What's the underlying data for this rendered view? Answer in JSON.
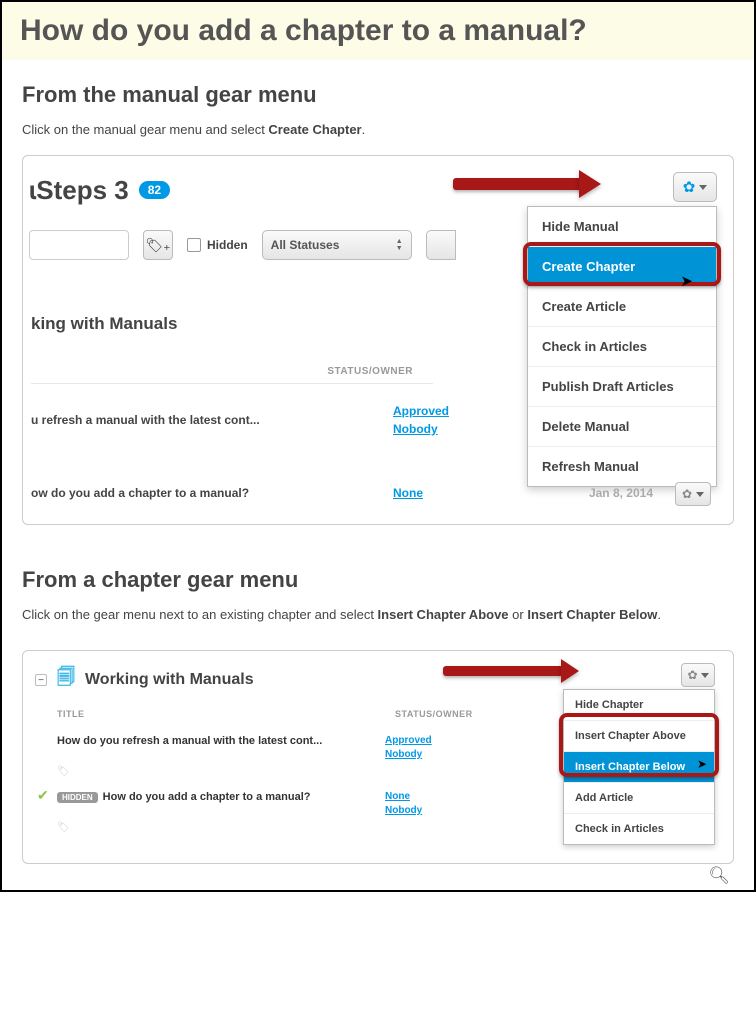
{
  "page": {
    "title": "How do you add a chapter to a manual?"
  },
  "section1": {
    "heading": "From the manual gear menu",
    "intro_a": "Click on the manual gear menu and select ",
    "intro_b": "Create Chapter",
    "intro_c": "."
  },
  "shot1": {
    "title_partial": "Steps 3",
    "badge": "82",
    "hidden_label": "Hidden",
    "statuses_label": "All Statuses",
    "dropdown": {
      "hide_manual": "Hide Manual",
      "create_chapter": "Create Chapter",
      "create_article": "Create Article",
      "check_in": "Check in Articles",
      "publish_draft": "Publish Draft Articles",
      "delete_manual": "Delete Manual",
      "refresh_manual": "Refresh Manual"
    },
    "section_label": "king with Manuals",
    "col_status": "STATUS/OWNER",
    "row1": {
      "title": "u refresh a manual with the latest cont...",
      "status": "Approved",
      "owner": "Nobody"
    },
    "row2": {
      "title": "ow do you add a chapter to a manual?",
      "status": "None",
      "date": "Jan 8, 2014"
    }
  },
  "section2": {
    "heading": "From a chapter gear menu",
    "intro_a": "Click on the gear menu next to an existing chapter and select ",
    "intro_b": "Insert Chapter Above",
    "intro_c": " or ",
    "intro_d": "Insert Chapter Below",
    "intro_e": "."
  },
  "shot2": {
    "chapter_title": "Working with Manuals",
    "col_title": "TITLE",
    "col_status": "STATUS/OWNER",
    "row1": {
      "title": "How do you refresh a manual with the latest cont...",
      "status": "Approved",
      "owner": "Nobody"
    },
    "row2": {
      "hidden_pill": "HIDDEN",
      "title": "How do you add a chapter to a manual?",
      "status": "None",
      "owner": "Nobody"
    },
    "menu": {
      "hide_chapter": "Hide Chapter",
      "insert_above": "Insert Chapter Above",
      "insert_below": "Insert Chapter Below",
      "add_article": "Add Article",
      "check_in": "Check in Articles"
    }
  }
}
